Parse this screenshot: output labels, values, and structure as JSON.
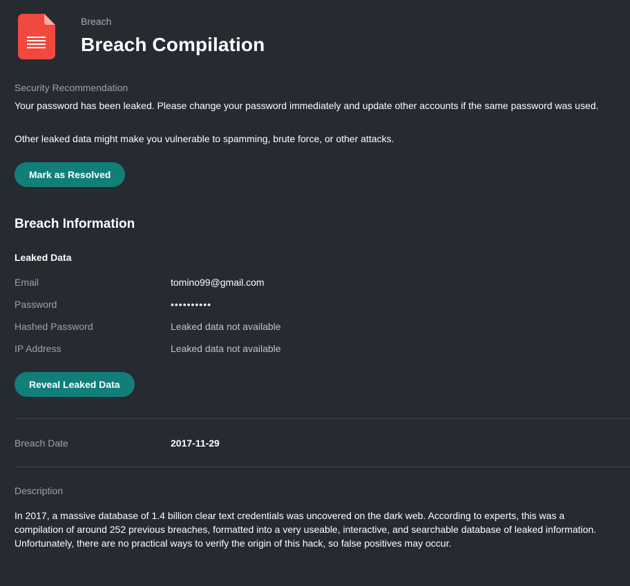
{
  "header": {
    "kicker": "Breach",
    "title": "Breach Compilation",
    "icon": "document-icon",
    "icon_color": "#f1483f"
  },
  "recommendation": {
    "label": "Security Recommendation",
    "line1": "Your password has been leaked. Please change your password immediately and update other accounts if the same password was used.",
    "line2": "Other leaked data might make you vulnerable to spamming, brute force, or other attacks.",
    "resolve_button": "Mark as Resolved"
  },
  "breach_info": {
    "heading": "Breach Information",
    "leaked_heading": "Leaked Data",
    "fields": [
      {
        "key": "Email",
        "value": "tomino99@gmail.com"
      },
      {
        "key": "Password",
        "value": "••••••••••"
      },
      {
        "key": "Hashed Password",
        "value": "Leaked data not available"
      },
      {
        "key": "IP Address",
        "value": "Leaked data not available"
      }
    ],
    "reveal_button": "Reveal Leaked Data"
  },
  "breach_date": {
    "label": "Breach Date",
    "value": "2017-11-29"
  },
  "description": {
    "label": "Description",
    "text": "In 2017, a massive database of 1.4 billion clear text credentials was uncovered on the dark web. According to experts, this was a compilation of around 252 previous breaches, formatted into a very useable, interactive, and searchable database of leaked information. Unfortunately, there are no practical ways to verify the origin of this hack, so false positives may occur."
  },
  "colors": {
    "background": "#262a31",
    "accent": "#117f78",
    "divider": "#40454d",
    "muted_text": "#9ea2a9"
  }
}
